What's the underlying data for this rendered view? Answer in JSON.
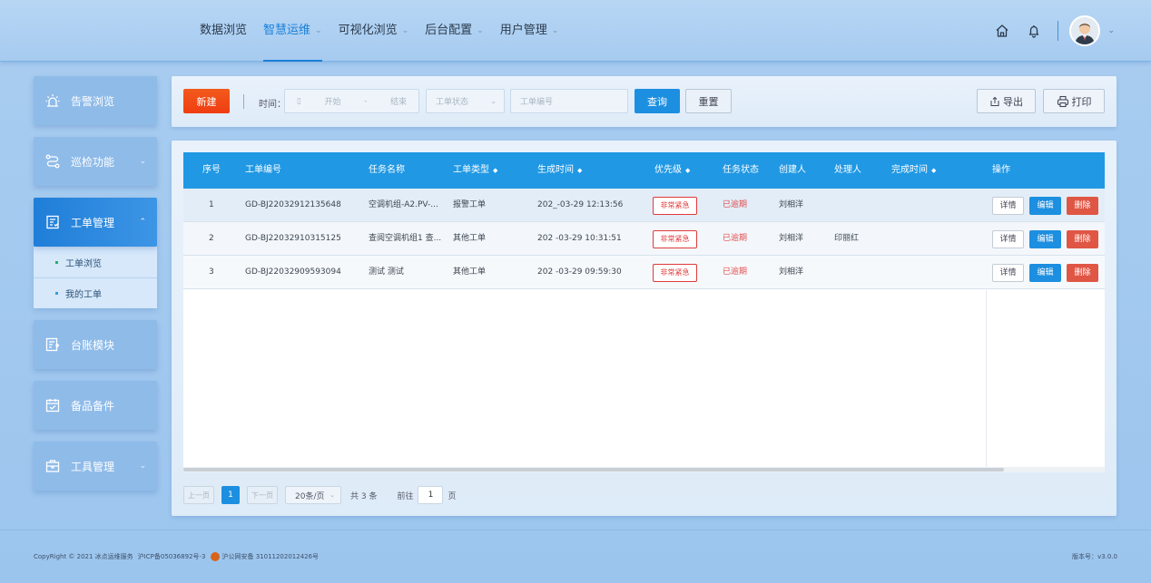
{
  "nav": {
    "items": [
      {
        "label": "数据浏览",
        "has_chevron": false,
        "active": false
      },
      {
        "label": "智慧运维",
        "has_chevron": true,
        "active": true
      },
      {
        "label": "可视化浏览",
        "has_chevron": true,
        "active": false
      },
      {
        "label": "后台配置",
        "has_chevron": true,
        "active": false
      },
      {
        "label": "用户管理",
        "has_chevron": true,
        "active": false
      }
    ]
  },
  "header_icons": [
    "home-icon",
    "bell-icon",
    "user-avatar",
    "chevron-down-icon"
  ],
  "sidebar": {
    "items": [
      {
        "label": "告警浏览",
        "icon": "alarm-icon"
      },
      {
        "label": "巡检功能",
        "icon": "route-icon"
      },
      {
        "label": "工单管理",
        "icon": "workorder-icon"
      },
      {
        "label": "台账模块",
        "icon": "ledger-icon"
      },
      {
        "label": "备品备件",
        "icon": "calendar-icon"
      },
      {
        "label": "工具管理",
        "icon": "toolbox-icon"
      }
    ],
    "submenu": [
      {
        "label": "工单浏览"
      },
      {
        "label": "我的工单"
      }
    ]
  },
  "filter": {
    "new_label": "新建",
    "time_label": "时间：",
    "start_placeholder": "开始",
    "date_sep": "-",
    "end_placeholder": "结束",
    "status_placeholder": "工单状态",
    "code_placeholder": "工单编号",
    "query_label": "查询",
    "reset_label": "重置",
    "export_label": "导出",
    "print_label": "打印"
  },
  "table": {
    "headers": {
      "index": "序号",
      "code": "工单编号",
      "task": "任务名称",
      "type": "工单类型",
      "created": "生成时间",
      "priority": "优先级",
      "status": "任务状态",
      "creator": "创建人",
      "handler": "处理人",
      "finished": "完成时间",
      "ops": "操作"
    },
    "rows": [
      {
        "index": "1",
        "code": "GD-BJ22032912135648",
        "task": "空调机组-A2.PV-...",
        "type": "报警工单",
        "created": "202_-03-29 12:13:56",
        "priority": "非常紧急",
        "status": "已逾期",
        "creator": "刘相洋",
        "handler": "",
        "finished": ""
      },
      {
        "index": "2",
        "code": "GD-BJ22032910315125",
        "task": "查阅空调机组1 查...",
        "type": "其他工单",
        "created": "202 -03-29 10:31:51",
        "priority": "非常紧急",
        "status": "已逾期",
        "creator": "刘相洋",
        "handler": "印丽红",
        "finished": ""
      },
      {
        "index": "3",
        "code": "GD-BJ22032909593094",
        "task": "测试 测试",
        "type": "其他工单",
        "created": "202 -03-29 09:59:30",
        "priority": "非常紧急",
        "status": "已逾期",
        "creator": "刘相洋",
        "handler": "",
        "finished": ""
      }
    ],
    "actions": {
      "detail": "详情",
      "edit": "编辑",
      "delete": "删除"
    }
  },
  "pager": {
    "prev": "上一页",
    "current": "1",
    "next": "下一页",
    "page_size": "20条/页",
    "total": "共 3 条",
    "goto_prefix": "前往",
    "goto_value": "1",
    "goto_suffix": "页"
  },
  "footer": {
    "copyright": "CopyRight © 2021 冰点运维服务",
    "icp": "沪ICP备05036892号-3",
    "police": "沪公网安备 31011202012426号",
    "version": "版本号：v3.0.0"
  },
  "colors": {
    "accent": "#1d8fe0",
    "table_header": "#2098e4",
    "new_button": "#f03d12",
    "delete_button": "#e05645",
    "priority_red": "#e23a3a"
  }
}
